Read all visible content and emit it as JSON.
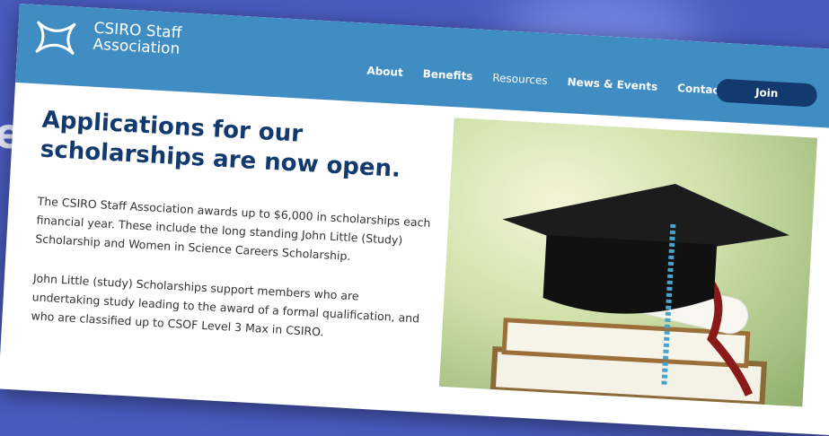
{
  "brand": {
    "line1": "CSIRO Staff",
    "line2": "Association"
  },
  "nav": {
    "items": [
      "About",
      "Benefits",
      "Resources",
      "News & Events",
      "Contact"
    ],
    "join_label": "Join"
  },
  "hero": {
    "headline": "Applications for our scholarships are now open.",
    "paragraph1": "The CSIRO Staff Association awards up to $6,000 in scholarships each financial year. These include the long standing John Little (Study) Scholarship and Women in Science Careers Scholarship.",
    "paragraph2": "John Little (study) Scholarships support members who are undertaking study leading to the award of a formal qualification, and who are classified up to CSOF Level 3 Max in CSIRO."
  },
  "background": {
    "side_letter": "e"
  },
  "colors": {
    "header": "#3f8dc2",
    "join": "#123a6e",
    "headline": "#123a6e",
    "background": "#4a5bbf"
  }
}
